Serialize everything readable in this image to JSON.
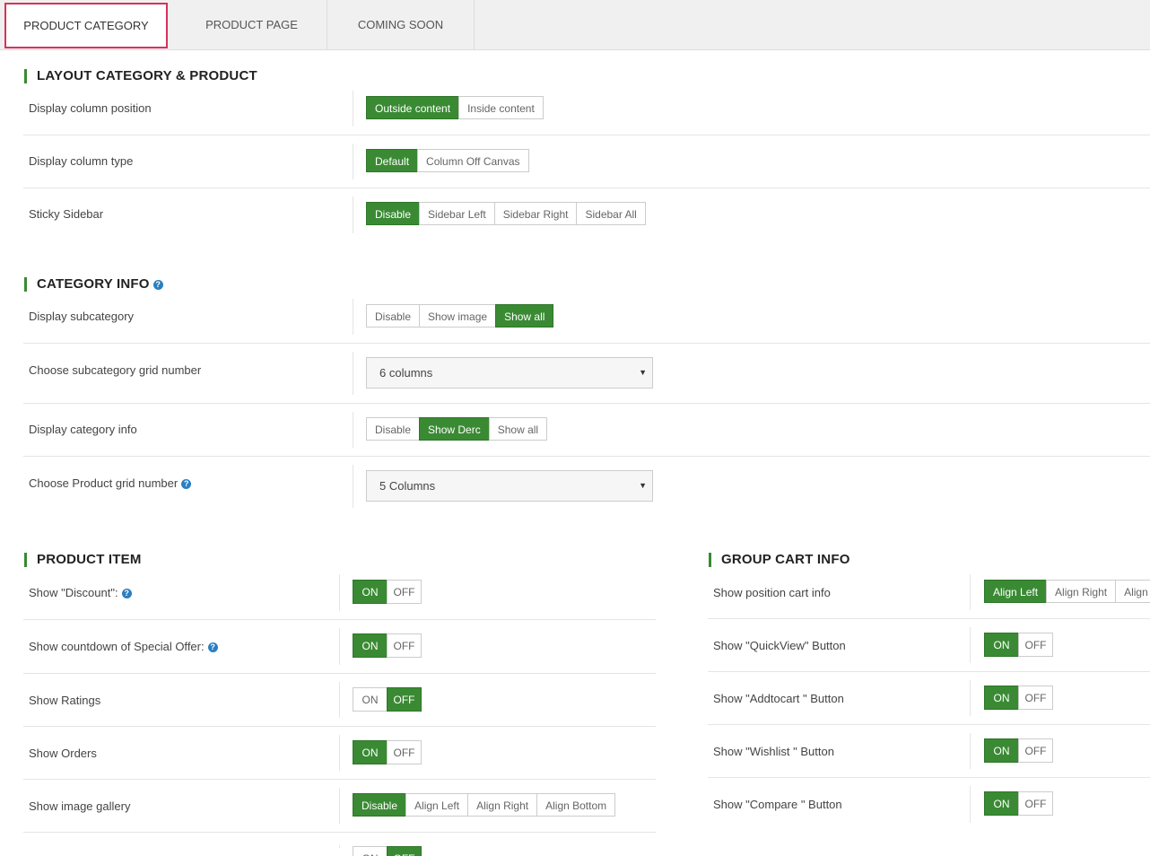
{
  "tabs": [
    {
      "label": "PRODUCT CATEGORY"
    },
    {
      "label": "PRODUCT PAGE"
    },
    {
      "label": "COMING SOON"
    }
  ],
  "layout": {
    "title": "LAYOUT CATEGORY & PRODUCT",
    "rows": [
      {
        "label": "Display column position",
        "options": [
          "Outside content",
          "Inside content"
        ],
        "selected": "Outside content"
      },
      {
        "label": "Display column type",
        "options": [
          "Default",
          "Column Off Canvas"
        ],
        "selected": "Default"
      },
      {
        "label": "Sticky Sidebar",
        "options": [
          "Disable",
          "Sidebar Left",
          "Sidebar Right",
          "Sidebar All"
        ],
        "selected": "Disable"
      }
    ]
  },
  "category": {
    "title": "CATEGORY INFO",
    "rows": [
      {
        "label": "Display subcategory",
        "options": [
          "Disable",
          "Show image",
          "Show all"
        ],
        "selected": "Show all"
      },
      {
        "label": "Choose subcategory grid number",
        "value": "6 columns"
      },
      {
        "label": "Display category info",
        "options": [
          "Disable",
          "Show Derc",
          "Show all"
        ],
        "selected": "Show Derc"
      },
      {
        "label": "Choose Product grid number",
        "value": "5 Columns"
      }
    ]
  },
  "product_item": {
    "title": "PRODUCT ITEM",
    "rows": [
      {
        "label": "Show \"Discount\":",
        "on": true
      },
      {
        "label": "Show countdown of Special Offer:",
        "on": true
      },
      {
        "label": "Show Ratings",
        "on": false
      },
      {
        "label": "Show Orders",
        "on": true
      },
      {
        "label": "Show image gallery",
        "options": [
          "Disable",
          "Align Left",
          "Align Right",
          "Align Bottom"
        ],
        "selected": "Disable"
      }
    ]
  },
  "group_cart": {
    "title": "GROUP CART INFO",
    "rows": [
      {
        "label": "Show position cart info",
        "options": [
          "Align Left",
          "Align Right",
          "Align"
        ],
        "selected": "Align Left"
      },
      {
        "label": "Show \"QuickView\" Button",
        "on": true
      },
      {
        "label": "Show \"Addtocart \" Button",
        "on": true
      },
      {
        "label": "Show \"Wishlist \" Button",
        "on": true
      },
      {
        "label": "Show \"Compare \" Button",
        "on": true
      }
    ]
  },
  "toggle_labels": {
    "on": "ON",
    "off": "OFF"
  },
  "help_glyph": "?",
  "select_caret": "▼",
  "colors": {
    "accent": "#3a8a34",
    "active_tab_border": "#d9305a",
    "help": "#2a7fc1"
  }
}
